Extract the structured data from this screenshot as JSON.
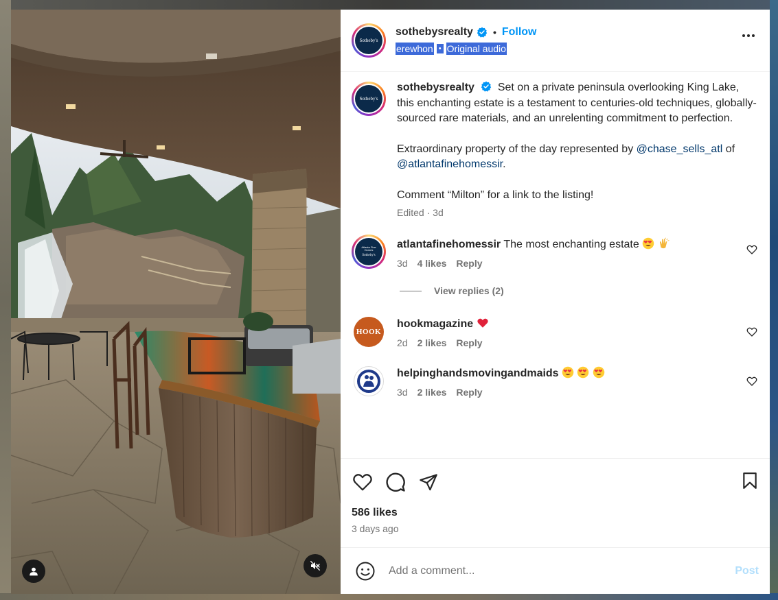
{
  "header": {
    "username": "sothebysrealty",
    "follow_label": "Follow",
    "audio_artist": "erewhon",
    "audio_separator": "•",
    "audio_label": "Original audio"
  },
  "caption": {
    "username": "sothebysrealty",
    "paragraph1": "Set on a private peninsula overlooking King Lake, this enchanting estate is a testament to centuries-old techniques, globally-sourced rare materials, and an unrelenting commitment to perfection.",
    "paragraph2_prefix": "Extraordinary property of the day represented by",
    "mention1": "@chase_sells_atl",
    "paragraph2_mid": "of",
    "mention2": "@atlantafinehomessir",
    "paragraph2_suffix": ".",
    "paragraph3": "Comment “Milton” for a link to the listing!",
    "edited": "Edited",
    "time": "3d"
  },
  "comments": [
    {
      "username": "atlantafinehomessir",
      "text": "The most enchanting estate",
      "emojis": [
        "heart-eyes",
        "clapping-hands"
      ],
      "time": "3d",
      "likes": "4 likes",
      "reply_label": "Reply"
    },
    {
      "username": "hookmagazine",
      "text": "",
      "emojis": [
        "red-heart"
      ],
      "time": "2d",
      "likes": "2 likes",
      "reply_label": "Reply"
    },
    {
      "username": "helpinghandsmovingandmaids",
      "text": "",
      "emojis": [
        "heart-eyes",
        "heart-eyes",
        "heart-eyes"
      ],
      "time": "3d",
      "likes": "2 likes",
      "reply_label": "Reply"
    }
  ],
  "view_replies_label": "View replies (2)",
  "avatars": {
    "sothebys_text": "Sotheby's",
    "atlanta_line1": "Atlanta Fine Homes",
    "hook_text": "HOOK"
  },
  "post": {
    "likes": "586 likes",
    "time_ago": "3 days ago"
  },
  "add_comment": {
    "placeholder": "Add a comment...",
    "post_label": "Post"
  },
  "icons": {
    "verified": "verified-badge-icon",
    "more": "more-options-icon",
    "like": "heart-outline-icon",
    "comment": "comment-bubble-icon",
    "share": "paper-plane-icon",
    "save": "bookmark-icon",
    "emoji": "smiley-icon",
    "user_tag": "person-icon",
    "mute": "speaker-muted-icon"
  },
  "colors": {
    "accent": "#0095f6",
    "mention": "#00376b",
    "muted_text": "#737373",
    "post_disabled": "#b2dffc",
    "selection_highlight": "#3d6ad9"
  }
}
